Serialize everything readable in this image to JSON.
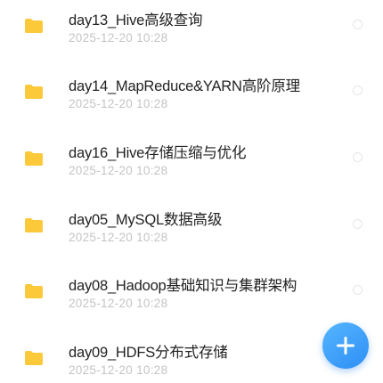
{
  "files": [
    {
      "name": "day13_Hive高级查询",
      "date": "2025-12-20  10:28"
    },
    {
      "name": "day14_MapReduce&YARN高阶原理",
      "date": "2025-12-20  10:28"
    },
    {
      "name": "day16_Hive存储压缩与优化",
      "date": "2025-12-20  10:28"
    },
    {
      "name": "day05_MySQL数据高级",
      "date": "2025-12-20  10:28"
    },
    {
      "name": "day08_Hadoop基础知识与集群架构",
      "date": "2025-12-20  10:28"
    },
    {
      "name": "day09_HDFS分布式存储",
      "date": "2025-12-20  10:28"
    }
  ],
  "icons": {
    "item": "folder-icon",
    "select": "radio-circle-icon",
    "fab": "plus-icon"
  },
  "colors": {
    "folder": "#fbc93a",
    "accent": "#3a9bf8",
    "name_text": "#222222",
    "date_text": "#c4c4c4"
  }
}
